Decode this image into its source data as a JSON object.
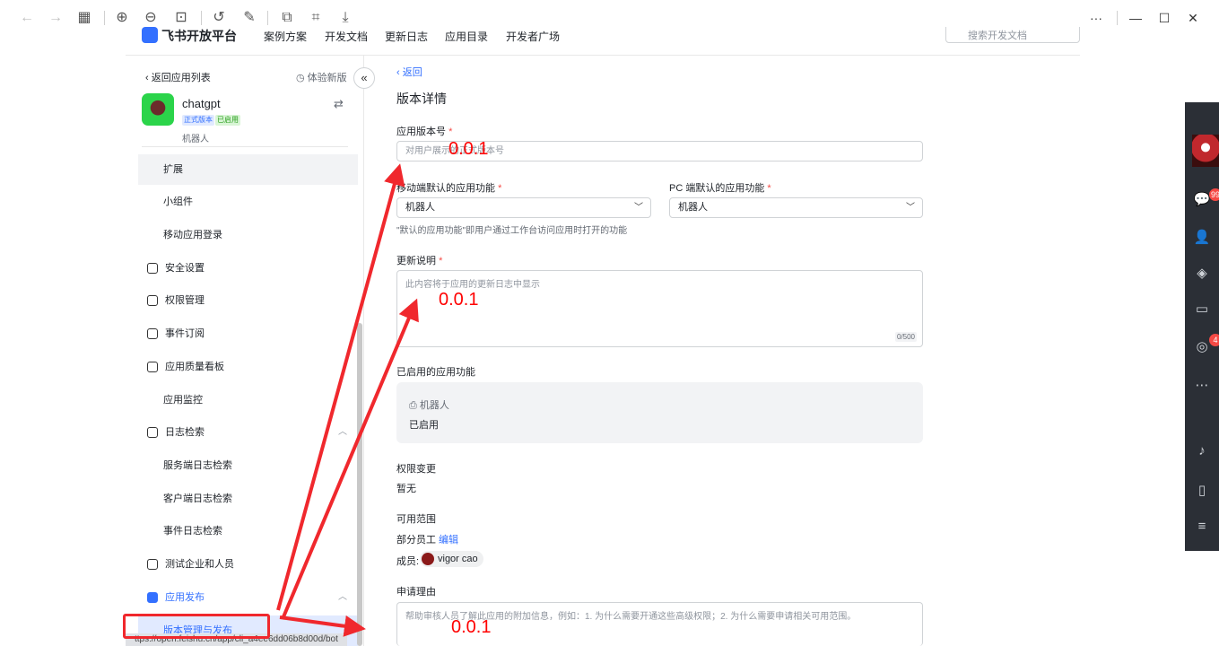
{
  "viewer": {
    "icons": [
      "back-arrow-icon",
      "forward-arrow-icon",
      "grid-icon",
      "zoom-in-icon",
      "zoom-out-icon",
      "fit-icon",
      "rotate-icon",
      "edit-icon",
      "ocr-icon",
      "crop-icon",
      "download-icon",
      "more-icon",
      "minimize-icon",
      "maximize-icon",
      "close-icon"
    ]
  },
  "portal": {
    "brand": "飞书开放平台",
    "nav": [
      "案例方案",
      "开发文档",
      "更新日志",
      "应用目录",
      "开发者广场"
    ],
    "search_placeholder": "搜索开发文档"
  },
  "sidebar": {
    "back_label": "返回应用列表",
    "try_new_label": "体验新版",
    "app": {
      "name": "chatgpt",
      "badge_release": "正式版本",
      "badge_enabled": "已启用",
      "type": "机器人"
    },
    "items": [
      {
        "label": "扩展",
        "kind": "sub"
      },
      {
        "label": "小组件",
        "kind": "sub"
      },
      {
        "label": "移动应用登录",
        "kind": "sub"
      },
      {
        "label": "安全设置",
        "kind": "group"
      },
      {
        "label": "权限管理",
        "kind": "group"
      },
      {
        "label": "事件订阅",
        "kind": "group"
      },
      {
        "label": "应用质量看板",
        "kind": "group"
      },
      {
        "label": "应用监控",
        "kind": "sub"
      },
      {
        "label": "日志检索",
        "kind": "group"
      },
      {
        "label": "服务端日志检索",
        "kind": "sub"
      },
      {
        "label": "客户端日志检索",
        "kind": "sub"
      },
      {
        "label": "事件日志检索",
        "kind": "sub"
      },
      {
        "label": "测试企业和人员",
        "kind": "group"
      },
      {
        "label": "应用发布",
        "kind": "group"
      },
      {
        "label": "版本管理与发布",
        "kind": "sub"
      }
    ],
    "status_url": "ttps://open.feishu.cn/app/cli_a4ee6dd06b8d00d/bot"
  },
  "content": {
    "back_label": "返回",
    "title": "版本详情",
    "version_label": "应用版本号",
    "version_placeholder": "对用户展示的正式版本号",
    "mobile_default_label": "移动端默认的应用功能",
    "mobile_default_value": "机器人",
    "pc_default_label": "PC 端默认的应用功能",
    "pc_default_value": "机器人",
    "default_hint": "\"默认的应用功能\"即用户通过工作台访问应用时打开的功能",
    "notes_label": "更新说明",
    "notes_placeholder": "此内容将于应用的更新日志中显示",
    "notes_counter": "0/500",
    "enabled_label": "已启用的应用功能",
    "enabled_feature": "机器人",
    "enabled_status": "已启用",
    "perm_label": "权限变更",
    "perm_value": "暂无",
    "scope_label": "可用范围",
    "scope_value": "部分员工",
    "scope_edit": "编辑",
    "members_label": "成员:",
    "member_name": "vigor cao",
    "reason_label": "申请理由",
    "reason_placeholder": "帮助审核人员了解此应用的附加信息，例如：1. 为什么需要开通这些高级权限；2. 为什么需要申请相关可用范围。"
  },
  "annotations": {
    "text1": "0.0.1",
    "text2": "0.0.1",
    "text3": "0.0.1",
    "color": "#ff0000"
  },
  "dock": {
    "chat_badge": "99",
    "app_badge": "4"
  },
  "colors": {
    "accent": "#3370ff",
    "required": "#f54a45",
    "dock_bg": "#2b2f36"
  }
}
